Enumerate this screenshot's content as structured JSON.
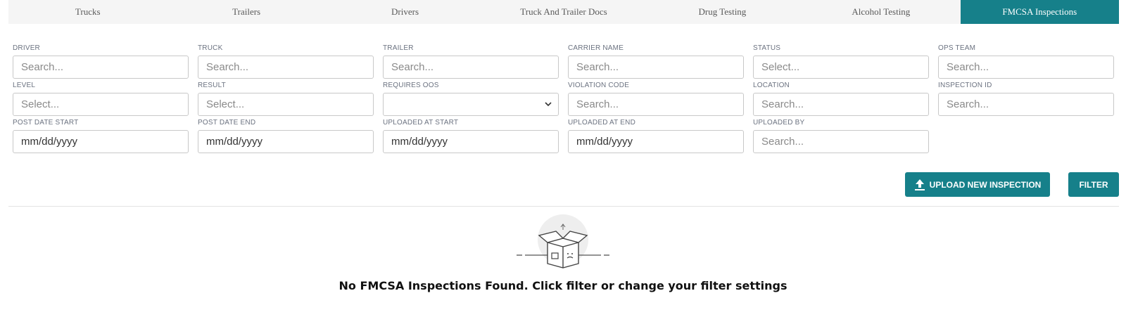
{
  "tabs": [
    {
      "label": "Trucks",
      "active": false
    },
    {
      "label": "Trailers",
      "active": false
    },
    {
      "label": "Drivers",
      "active": false
    },
    {
      "label": "Truck And Trailer Docs",
      "active": false
    },
    {
      "label": "Drug Testing",
      "active": false
    },
    {
      "label": "Alcohol Testing",
      "active": false
    },
    {
      "label": "FMCSA Inspections",
      "active": true
    }
  ],
  "filters": {
    "driver": {
      "label": "DRIVER",
      "placeholder": "Search..."
    },
    "truck": {
      "label": "TRUCK",
      "placeholder": "Search..."
    },
    "trailer": {
      "label": "TRAILER",
      "placeholder": "Search..."
    },
    "carrier_name": {
      "label": "CARRIER NAME",
      "placeholder": "Search..."
    },
    "status": {
      "label": "STATUS",
      "placeholder": "Select..."
    },
    "ops_team": {
      "label": "OPS TEAM",
      "placeholder": "Search..."
    },
    "level": {
      "label": "LEVEL",
      "placeholder": "Select..."
    },
    "result": {
      "label": "RESULT",
      "placeholder": "Select..."
    },
    "requires_oos": {
      "label": "REQUIRES OOS",
      "value": ""
    },
    "violation_code": {
      "label": "VIOLATION CODE",
      "placeholder": "Search..."
    },
    "location": {
      "label": "LOCATION",
      "placeholder": "Search..."
    },
    "inspection_id": {
      "label": "INSPECTION ID",
      "placeholder": "Search..."
    },
    "post_date_start": {
      "label": "POST DATE START",
      "placeholder": "mm/dd/yyyy"
    },
    "post_date_end": {
      "label": "POST DATE END",
      "placeholder": "mm/dd/yyyy"
    },
    "uploaded_at_start": {
      "label": "UPLOADED AT START",
      "placeholder": "mm/dd/yyyy"
    },
    "uploaded_at_end": {
      "label": "UPLOADED AT END",
      "placeholder": "mm/dd/yyyy"
    },
    "uploaded_by": {
      "label": "UPLOADED BY",
      "placeholder": "Search..."
    }
  },
  "actions": {
    "upload_label": "UPLOAD NEW INSPECTION",
    "upload_icon": "upload-icon",
    "filter_label": "FILTER"
  },
  "empty_state": {
    "icon": "empty-box-icon",
    "message": "No FMCSA Inspections Found. Click filter or change your filter settings"
  },
  "colors": {
    "accent": "#16808a",
    "tab_bar_bg": "#f5f5f5"
  }
}
